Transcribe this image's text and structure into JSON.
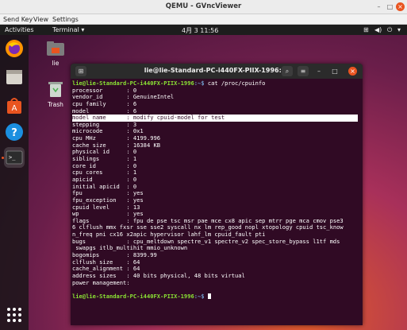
{
  "host_window": {
    "title": "QEMU - GVncViewer",
    "menu": [
      "Send Key",
      "View",
      "Settings"
    ]
  },
  "topbar": {
    "activities": "Activities",
    "app_menu": "Terminal ▾",
    "clock": "4月 3 11:56",
    "status_icons": [
      "network-icon",
      "volume-icon",
      "power-icon",
      "menu-chevron-icon"
    ]
  },
  "desktop_icons": [
    {
      "label": "lie",
      "icon": "home-folder-icon"
    },
    {
      "label": "Trash",
      "icon": "trash-icon"
    }
  ],
  "dock": [
    "firefox-icon",
    "files-icon",
    "software-icon",
    "help-icon",
    "terminal-icon",
    "apps-grid-icon"
  ],
  "terminal": {
    "title": "lie@lie-Standard-PC-i440FX-PIIX-1996: ~",
    "prompt_user": "lie@lie-Standard-PC-i440FX-PIIX-1996",
    "prompt_path": ":~$",
    "command": " cat /proc/cpuinfo",
    "lines": [
      "processor       : 0",
      "vendor_id       : GenuineIntel",
      "cpu family      : 6",
      "model           : 6"
    ],
    "highlight_line": "model name      : modify cpuid-model for test",
    "lines_after": [
      "stepping        : 3",
      "microcode       : 0x1",
      "cpu MHz         : 4199.996",
      "cache size      : 16384 KB",
      "physical id     : 0",
      "siblings        : 1",
      "core id         : 0",
      "cpu cores       : 1",
      "apicid          : 0",
      "initial apicid  : 0",
      "fpu             : yes",
      "fpu_exception   : yes",
      "cpuid level     : 13",
      "wp              : yes",
      "flags           : fpu de pse tsc msr pae mce cx8 apic sep mtrr pge mca cmov pse3",
      "6 clflush mmx fxsr sse sse2 syscall nx lm rep_good nopl xtopology cpuid tsc_know",
      "n_freq pni cx16 x2apic hypervisor lahf_lm cpuid_fault pti",
      "bugs            : cpu_meltdown spectre_v1 spectre_v2 spec_store_bypass l1tf mds",
      " swapgs itlb_multihit mmio_unknown",
      "bogomips        : 8399.99",
      "clflush size    : 64",
      "cache_alignment : 64",
      "address sizes   : 40 bits physical, 48 bits virtual",
      "power management:",
      ""
    ],
    "final_prompt_path": ":~$"
  }
}
